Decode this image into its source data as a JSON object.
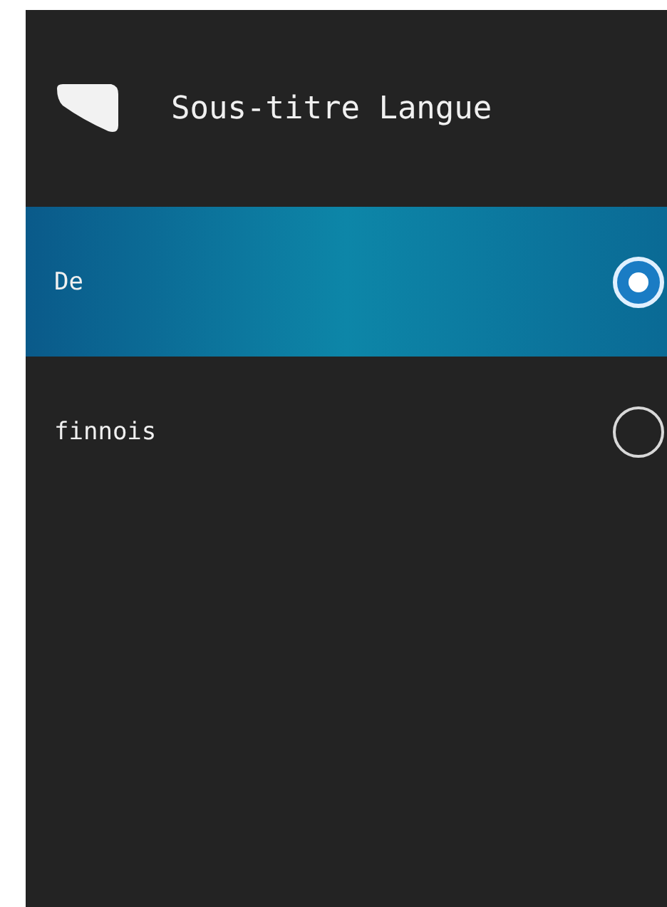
{
  "title": "Sous-titre Langue",
  "options": [
    {
      "label": "De",
      "selected": true
    },
    {
      "label": "finnois",
      "selected": false
    }
  ]
}
